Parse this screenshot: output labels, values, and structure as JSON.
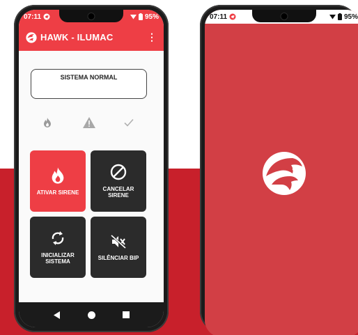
{
  "colors": {
    "accent": "#ee3e45",
    "splash": "#d23f45",
    "band": "#c8202b",
    "tile_dark": "#2b2b2b"
  },
  "phone_left": {
    "status_bar": {
      "time": "07:11",
      "battery": "95%",
      "icons": [
        "app-notification-icon",
        "wifi-icon",
        "battery-icon"
      ]
    },
    "app_bar": {
      "title": "HAWK - ILUMAC",
      "menu": "⋮",
      "logo_icon": "hawk-logo-icon"
    },
    "status_box": {
      "text": "SISTEMA NORMAL"
    },
    "indicators": [
      {
        "icon": "fire-indicator-icon"
      },
      {
        "icon": "warning-indicator-icon"
      },
      {
        "icon": "check-indicator-icon"
      }
    ],
    "buttons": {
      "activate": {
        "label": "ATIVAR SIRENE",
        "icon": "fire-icon"
      },
      "cancel": {
        "label": "CANCELAR\nSIRENE",
        "icon": "block-icon"
      },
      "init": {
        "label": "INICIALIZAR\nSISTEMA",
        "icon": "refresh-icon"
      },
      "silence": {
        "label": "SILÊNCIAR BIP",
        "icon": "mute-icon"
      }
    },
    "nav": {
      "back": "back-icon",
      "home": "home-icon",
      "recents": "recents-icon"
    }
  },
  "phone_right": {
    "status_bar": {
      "time": "07:11",
      "battery": "95%"
    },
    "splash_logo": "hawk-logo-icon"
  }
}
